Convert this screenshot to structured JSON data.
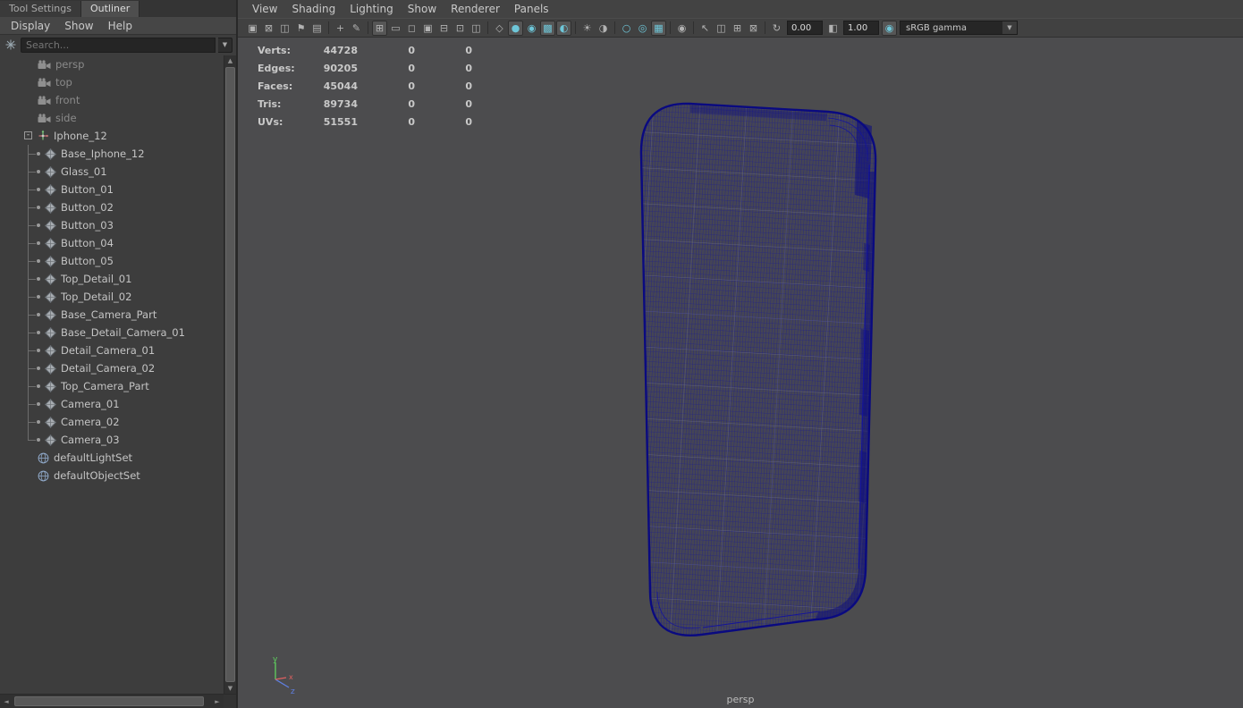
{
  "window": {
    "left_tabs": [
      {
        "label": "Tool Settings",
        "active": false
      },
      {
        "label": "Outliner",
        "active": true
      }
    ]
  },
  "outliner": {
    "menus": [
      "Display",
      "Show",
      "Help"
    ],
    "search_placeholder": "Search...",
    "items": [
      {
        "label": "persp",
        "icon": "camera",
        "style": "camera",
        "dim": true
      },
      {
        "label": "top",
        "icon": "camera",
        "style": "camera",
        "dim": true
      },
      {
        "label": "front",
        "icon": "camera",
        "style": "camera",
        "dim": true
      },
      {
        "label": "side",
        "icon": "camera",
        "style": "camera",
        "dim": true
      },
      {
        "label": "Iphone_12",
        "icon": "transform",
        "style": "group",
        "expanded": true
      },
      {
        "label": "Base_Iphone_12",
        "icon": "mesh",
        "style": "child"
      },
      {
        "label": "Glass_01",
        "icon": "mesh",
        "style": "child"
      },
      {
        "label": "Button_01",
        "icon": "mesh",
        "style": "child"
      },
      {
        "label": "Button_02",
        "icon": "mesh",
        "style": "child"
      },
      {
        "label": "Button_03",
        "icon": "mesh",
        "style": "child"
      },
      {
        "label": "Button_04",
        "icon": "mesh",
        "style": "child"
      },
      {
        "label": "Button_05",
        "icon": "mesh",
        "style": "child"
      },
      {
        "label": "Top_Detail_01",
        "icon": "mesh",
        "style": "child"
      },
      {
        "label": "Top_Detail_02",
        "icon": "mesh",
        "style": "child"
      },
      {
        "label": "Base_Camera_Part",
        "icon": "mesh",
        "style": "child"
      },
      {
        "label": "Base_Detail_Camera_01",
        "icon": "mesh",
        "style": "child"
      },
      {
        "label": "Detail_Camera_01",
        "icon": "mesh",
        "style": "child"
      },
      {
        "label": "Detail_Camera_02",
        "icon": "mesh",
        "style": "child"
      },
      {
        "label": "Top_Camera_Part",
        "icon": "mesh",
        "style": "child"
      },
      {
        "label": "Camera_01",
        "icon": "mesh",
        "style": "child"
      },
      {
        "label": "Camera_02",
        "icon": "mesh",
        "style": "child"
      },
      {
        "label": "Camera_03",
        "icon": "mesh",
        "style": "child",
        "last": true
      },
      {
        "label": "defaultLightSet",
        "icon": "set",
        "style": "root"
      },
      {
        "label": "defaultObjectSet",
        "icon": "set",
        "style": "root"
      }
    ]
  },
  "viewport": {
    "menus": [
      "View",
      "Shading",
      "Lighting",
      "Show",
      "Renderer",
      "Panels"
    ],
    "toolbar": [
      {
        "type": "icon",
        "name": "select-camera",
        "glyph": "▣"
      },
      {
        "type": "icon",
        "name": "lock-camera",
        "glyph": "⊠"
      },
      {
        "type": "icon",
        "name": "camera-attributes",
        "glyph": "◫"
      },
      {
        "type": "icon",
        "name": "bookmark",
        "glyph": "⚑"
      },
      {
        "type": "icon",
        "name": "image-plane",
        "glyph": "▤"
      },
      {
        "type": "sep"
      },
      {
        "type": "icon",
        "name": "2d-pan-zoom",
        "glyph": "+"
      },
      {
        "type": "icon",
        "name": "grease-pencil",
        "glyph": "✎"
      },
      {
        "type": "sep"
      },
      {
        "type": "icon",
        "name": "grid",
        "glyph": "⊞",
        "active": true
      },
      {
        "type": "icon",
        "name": "film-gate",
        "glyph": "▭"
      },
      {
        "type": "icon",
        "name": "resolution-gate",
        "glyph": "◻"
      },
      {
        "type": "icon",
        "name": "gate-mask",
        "glyph": "▣"
      },
      {
        "type": "icon",
        "name": "field-chart",
        "glyph": "⊟"
      },
      {
        "type": "icon",
        "name": "safe-action",
        "glyph": "⊡"
      },
      {
        "type": "icon",
        "name": "safe-title",
        "glyph": "◫"
      },
      {
        "type": "sep"
      },
      {
        "type": "icon",
        "name": "wireframe-mode",
        "glyph": "◇"
      },
      {
        "type": "icon",
        "name": "smooth-shade-mode",
        "glyph": "●",
        "active": true,
        "tint": true
      },
      {
        "type": "icon",
        "name": "wireframe-on-shaded",
        "glyph": "◉",
        "tint": true
      },
      {
        "type": "icon",
        "name": "textured-mode",
        "glyph": "▩",
        "active": true,
        "tint": true
      },
      {
        "type": "icon",
        "name": "use-default-material",
        "glyph": "◐",
        "active": true,
        "tint": true
      },
      {
        "type": "sep"
      },
      {
        "type": "icon",
        "name": "all-lights",
        "glyph": "☀"
      },
      {
        "type": "icon",
        "name": "shadows",
        "glyph": "◑"
      },
      {
        "type": "sep"
      },
      {
        "type": "icon",
        "name": "ambient-occlusion",
        "glyph": "○",
        "tint": true
      },
      {
        "type": "icon",
        "name": "motion-blur",
        "glyph": "◎",
        "tint": true
      },
      {
        "type": "icon",
        "name": "multisample-aa",
        "glyph": "▦",
        "active": true,
        "tint": true
      },
      {
        "type": "sep"
      },
      {
        "type": "icon",
        "name": "isolate-select",
        "glyph": "◉"
      },
      {
        "type": "sep"
      },
      {
        "type": "icon",
        "name": "select-tool",
        "glyph": "↖"
      },
      {
        "type": "icon",
        "name": "copy-view",
        "glyph": "◫"
      },
      {
        "type": "icon",
        "name": "paste-view",
        "glyph": "⊞"
      },
      {
        "type": "icon",
        "name": "snapshot",
        "glyph": "⊠"
      },
      {
        "type": "sep"
      },
      {
        "type": "icon",
        "name": "refresh",
        "glyph": "↻"
      },
      {
        "type": "field",
        "name": "exposure",
        "value": "0.00"
      },
      {
        "type": "icon",
        "name": "gamma-toggle",
        "glyph": "◧"
      },
      {
        "type": "field",
        "name": "gamma",
        "value": "1.00"
      },
      {
        "type": "icon",
        "name": "color-managed",
        "glyph": "◉",
        "active": true,
        "tint": true
      },
      {
        "type": "select",
        "name": "view-transform",
        "value": "sRGB gamma"
      }
    ],
    "hud": {
      "rows": [
        {
          "label": "Verts:",
          "total": "44728",
          "col2": "0",
          "col3": "0"
        },
        {
          "label": "Edges:",
          "total": "90205",
          "col2": "0",
          "col3": "0"
        },
        {
          "label": "Faces:",
          "total": "45044",
          "col2": "0",
          "col3": "0"
        },
        {
          "label": "Tris:",
          "total": "89734",
          "col2": "0",
          "col3": "0"
        },
        {
          "label": "UVs:",
          "total": "51551",
          "col2": "0",
          "col3": "0"
        }
      ]
    },
    "camera_label": "persp",
    "axis_labels": {
      "x": "x",
      "y": "y",
      "z": "z"
    },
    "colors": {
      "wireframe": "#14149b",
      "wireframe_dark": "#0a0a80",
      "accent_teal": "#6ec6d8",
      "viewport_bg": "#4c4c4e"
    }
  }
}
